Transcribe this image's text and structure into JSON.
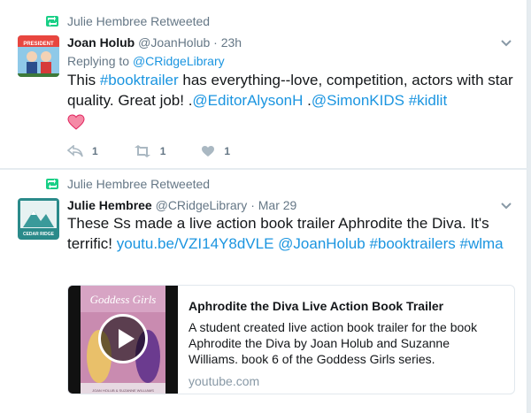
{
  "tweets": [
    {
      "context": "Julie Hembree Retweeted",
      "name": "Joan Holub",
      "handle": "@JoanHolub",
      "dot": "·",
      "time": "23h",
      "replying_prefix": "Replying to",
      "replying_handle": "@CRidgeLibrary",
      "text_parts": [
        "This ",
        "#booktrailer",
        " has everything--love, competition, actors with star quality. Great job! .",
        "@EditorAlysonH",
        " .",
        "@SimonKIDS",
        " ",
        "#kidlit"
      ],
      "actions": {
        "reply": "1",
        "retweet": "1",
        "like": "1"
      },
      "avatar_text": "PRESIDENT"
    },
    {
      "context": "Julie Hembree Retweeted",
      "name": "Julie Hembree",
      "handle": "@CRidgeLibrary",
      "dot": "·",
      "time": "Mar 29",
      "text_parts": [
        "These Ss made a live action book trailer Aphrodite the Diva. It's terrific! ",
        "youtu.be/VZI14Y8dVLE",
        " ",
        "@JoanHolub",
        " ",
        "#booktrailers",
        " ",
        "#wlma"
      ],
      "avatar_text": "CEDAR RIDGE",
      "card": {
        "title": "Aphrodite the Diva Live Action Book Trailer",
        "description": "A student created live action book trailer for the book Aphrodite the Diva by Joan Holub and Suzanne Williams. book 6 of the Goddess Girls series.",
        "domain": "youtube.com",
        "thumb_title": "Goddess Girls",
        "thumb_authors": "JOAN HOLUB & SUZANNE WILLIAMS"
      }
    }
  ],
  "colors": {
    "link": "#1b95e0",
    "retweet": "#19cf86",
    "muted": "#657786",
    "heart": "#e0245e"
  }
}
